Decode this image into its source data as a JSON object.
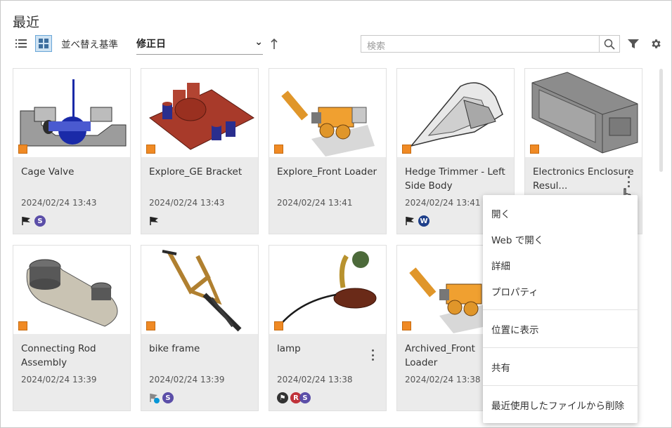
{
  "page": {
    "title": "最近"
  },
  "toolbar": {
    "sort_label": "並べ替え基準",
    "sort_value": "修正日",
    "search_placeholder": "検索",
    "view_modes": [
      "list",
      "grid"
    ],
    "active_view": "grid"
  },
  "cards": [
    {
      "name": "Cage Valve",
      "date": "2024/02/24 13:43",
      "badges": [
        "flag",
        "S"
      ]
    },
    {
      "name": "Explore_GE Bracket",
      "date": "2024/02/24 13:43",
      "badges": [
        "flag"
      ]
    },
    {
      "name": "Explore_Front Loader",
      "date": "2024/02/24 13:41",
      "badges": []
    },
    {
      "name": "Hedge Trimmer - Left Side Body",
      "date": "2024/02/24 13:41",
      "badges": [
        "flag",
        "W"
      ]
    },
    {
      "name": "Electronics Enclosure Resul...",
      "date": "",
      "badges": []
    },
    {
      "name": "Connecting Rod Assembly",
      "date": "2024/02/24 13:39",
      "badges": []
    },
    {
      "name": "bike frame",
      "date": "2024/02/24 13:39",
      "badges": [
        "flag-gray",
        "S"
      ]
    },
    {
      "name": "lamp",
      "date": "2024/02/24 13:38",
      "badges": [
        "flag-circle",
        "R",
        "S"
      ]
    },
    {
      "name": "Archived_Front Loader",
      "date": "2024/02/24 13:38",
      "badges": []
    }
  ],
  "context_menu": {
    "items": [
      {
        "label": "開く"
      },
      {
        "label": "Web で開く"
      },
      {
        "label": "詳細"
      },
      {
        "label": "プロパティ"
      },
      {
        "label": "位置に表示"
      },
      {
        "label": "共有"
      },
      {
        "label": "最近使用したファイルから削除"
      }
    ]
  },
  "colors": {
    "accent": "#0696d7",
    "cube": "#f08a24",
    "avatar_s": "#5b4ea8",
    "avatar_w": "#1e3f8a",
    "avatar_r": "#c0323a",
    "card_bg": "#ebebeb"
  }
}
